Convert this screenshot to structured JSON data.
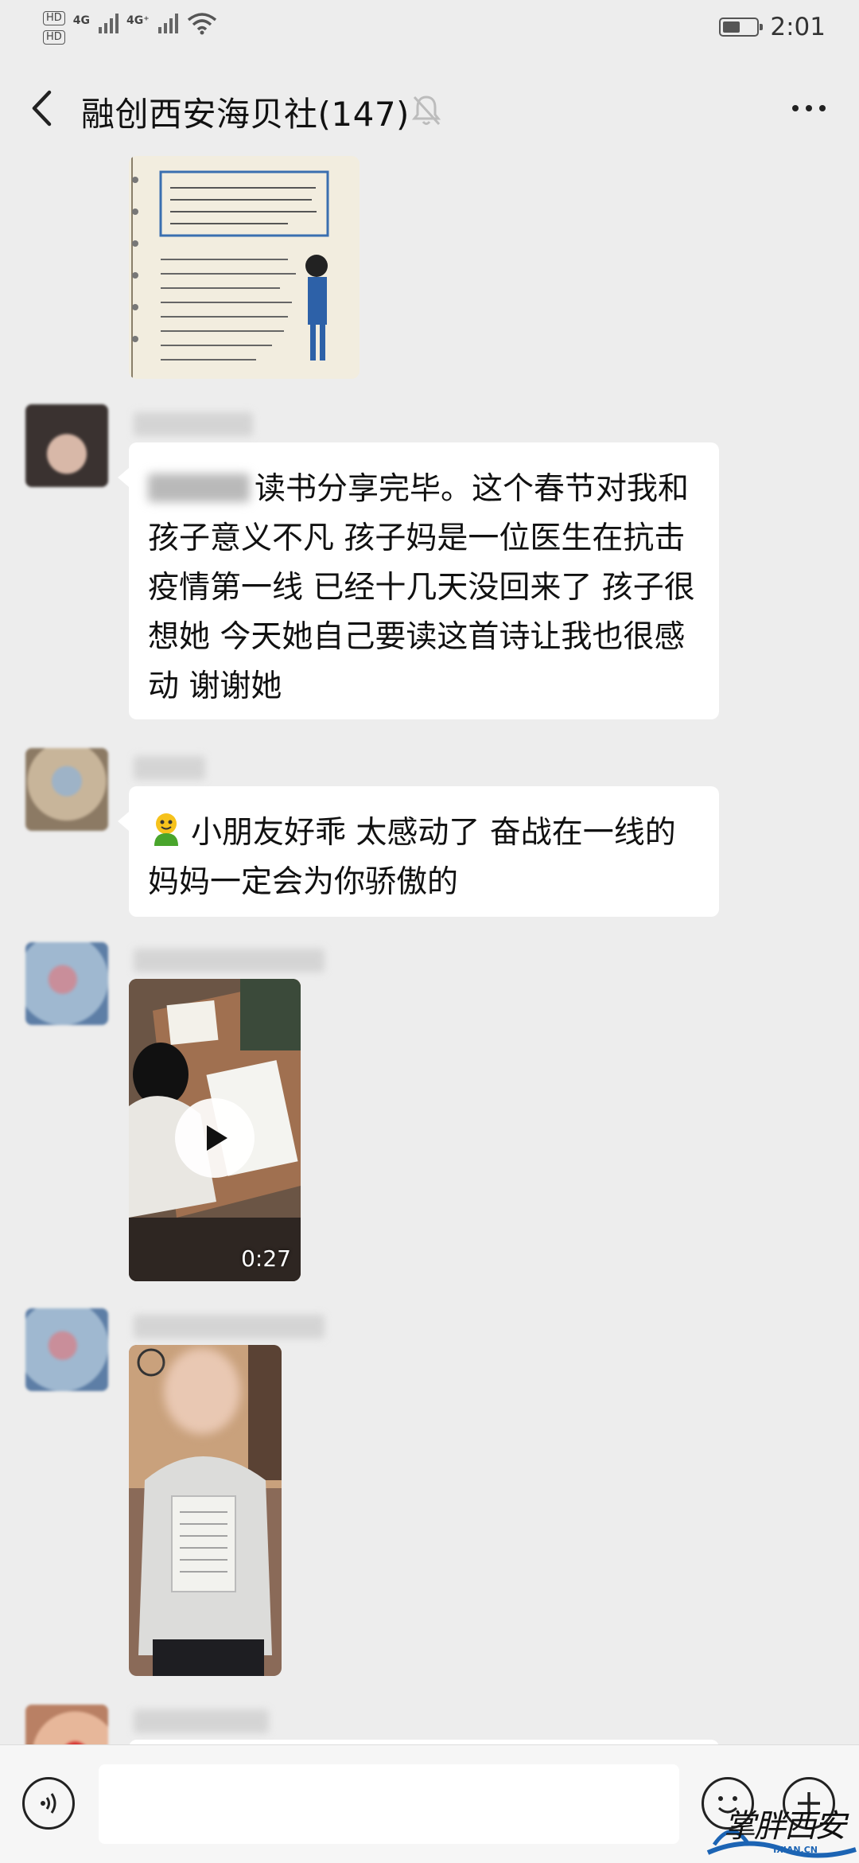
{
  "status_bar": {
    "hd_1": "HD",
    "hd_2": "HD",
    "network_1": "4G",
    "network_2": "4G⁺",
    "battery_level": 0.55,
    "time": "2:01"
  },
  "header": {
    "title": "融创西安海贝社(147)",
    "back_icon": "chevron-left-icon",
    "mute_icon": "bell-muted-icon",
    "more_icon": "more-dots-icon"
  },
  "messages": [
    {
      "type": "image",
      "content": "handwritten-notebook-page"
    },
    {
      "type": "text",
      "text": "读书分享完毕。这个春节对我和孩子意义不凡 孩子妈是一位医生在抗击疫情第一线 已经十几天没回来了 孩子很想她 今天她自己要读这首诗让我也很感动 谢谢她"
    },
    {
      "type": "text",
      "emoji": "smiley-emoji",
      "text": "小朋友好乖  太感动了 奋战在一线的妈妈一定会为你骄傲的"
    },
    {
      "type": "video",
      "duration": "0:27"
    },
    {
      "type": "image",
      "content": "child-holding-paper"
    }
  ],
  "input_bar": {
    "voice_icon": "voice-icon",
    "input_value": "",
    "emoji_icon": "emoji-icon",
    "plus_icon": "plus-icon"
  },
  "watermark": {
    "text": "掌胖西安",
    "sub": "IXIAN.CN"
  },
  "colors": {
    "background": "#ededed",
    "bubble": "#ffffff",
    "text": "#111111"
  }
}
